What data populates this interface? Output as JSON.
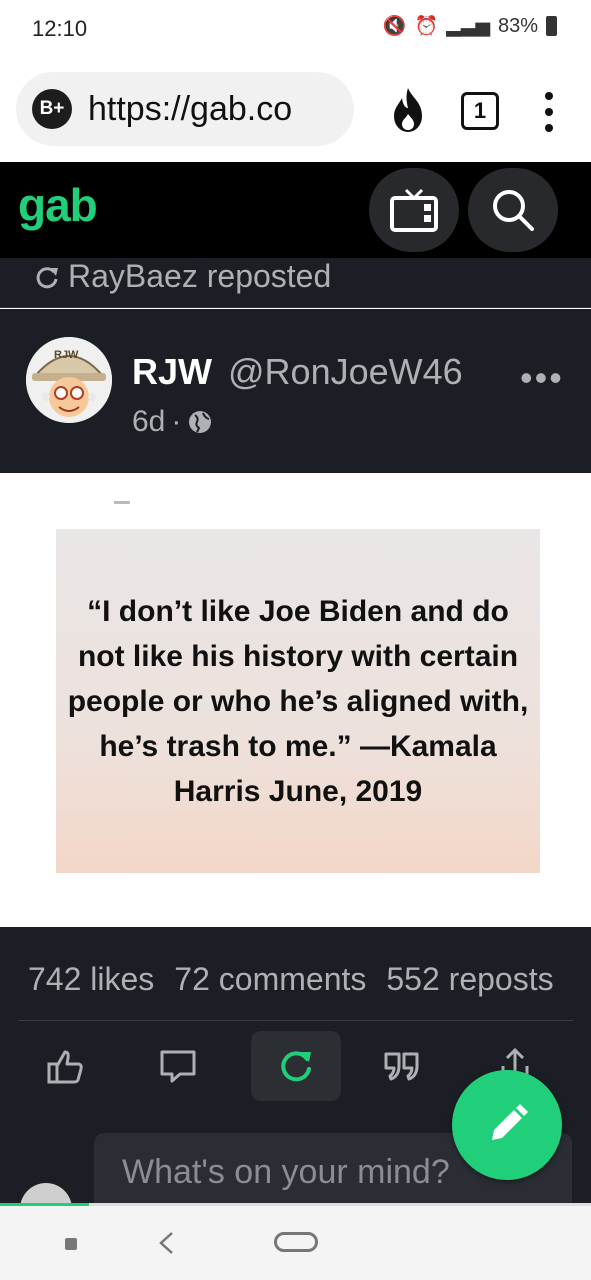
{
  "status_bar": {
    "time": "12:10",
    "battery": "83%"
  },
  "browser": {
    "url": "https://gab.co",
    "logo_badge": "B+",
    "tab_count": "1"
  },
  "gab": {
    "logo": "gab"
  },
  "repost": {
    "text": "RayBaez reposted"
  },
  "post": {
    "author_name": "RJW",
    "author_handle": "@RonJoeW46",
    "avatar_badge": "RJW",
    "age": "6d",
    "separator": "·",
    "more": "•••",
    "image_text": "“I don’t like Joe Biden and do not like his history with certain people or who he’s aligned with, he’s trash to me.” —Kamala Harris June, 2019"
  },
  "stats": {
    "likes": "742 likes",
    "comments": "72 comments",
    "reposts": "552 reposts"
  },
  "composer": {
    "placeholder": "What's on your mind?"
  },
  "colors": {
    "brand": "#21cf7a",
    "dark_bg": "#1b1e24",
    "header_bg": "#000000"
  },
  "icons": [
    "mute-icon",
    "alarm-icon",
    "lte-signal-icon",
    "fire-icon",
    "tv-icon",
    "search-icon",
    "globe-icon",
    "like-icon",
    "comment-icon",
    "repost-icon",
    "quote-icon",
    "share-icon",
    "pencil-icon"
  ],
  "page_load_progress": 0.15
}
